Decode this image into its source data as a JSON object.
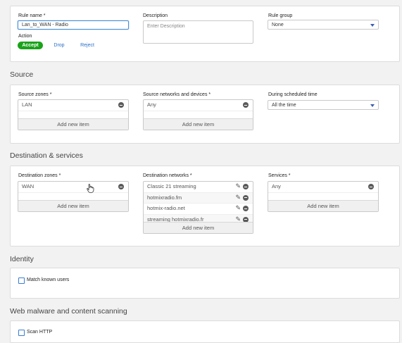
{
  "rule": {
    "name_label": "Rule name *",
    "name_value": "Lan_to_WAN - Radio",
    "description_label": "Description",
    "description_placeholder": "Enter Description",
    "group_label": "Rule group",
    "group_value": "None",
    "action_label": "Action",
    "actions": [
      "Accept",
      "Drop",
      "Reject"
    ],
    "selected_action": "Accept"
  },
  "source": {
    "title": "Source",
    "zones_label": "Source zones *",
    "zones": [
      "LAN"
    ],
    "networks_label": "Source networks and devices *",
    "networks": [
      "Any"
    ],
    "schedule_label": "During scheduled time",
    "schedule_value": "All the time",
    "add_item": "Add new item"
  },
  "destination": {
    "title": "Destination & services",
    "zones_label": "Destination zones *",
    "zones": [
      "WAN"
    ],
    "networks_label": "Destination networks *",
    "networks": [
      "Classic 21 streaming",
      "hotmixradio.fm",
      "hotmix-radio.net",
      "streaming hotmixradio.fr"
    ],
    "services_label": "Services *",
    "services": [
      "Any"
    ],
    "add_item": "Add new item"
  },
  "identity": {
    "title": "Identity",
    "match_known_users": "Match known users"
  },
  "scanning": {
    "title": "Web malware and content scanning",
    "scan_http": "Scan HTTP"
  },
  "colors": {
    "accept_green": "#1aa31a",
    "link_blue": "#2a6fc9",
    "focus_blue": "#4a90d9"
  }
}
